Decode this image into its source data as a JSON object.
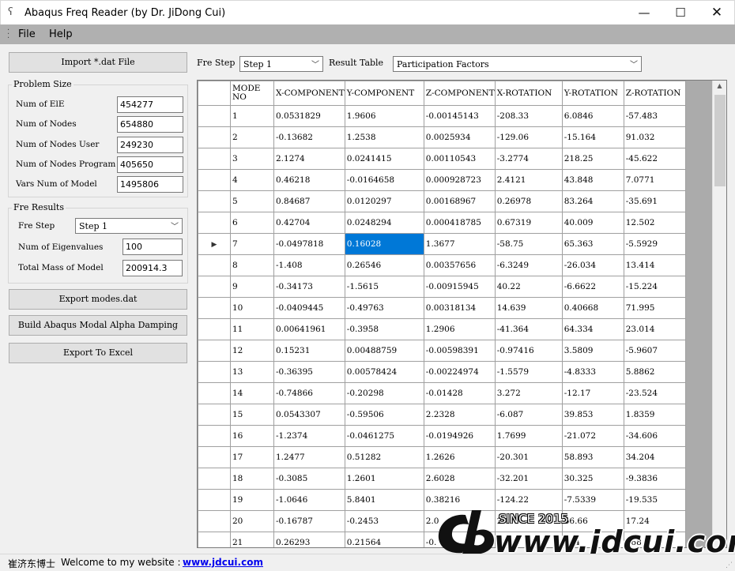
{
  "window": {
    "title": "Abaqus Freq Reader (by Dr. JiDong Cui)",
    "min_glyph": "—",
    "max_glyph": "☐",
    "close_glyph": "✕"
  },
  "menu": {
    "file": "File",
    "help": "Help"
  },
  "left_panel": {
    "import_button": "Import *.dat File",
    "problem_size": {
      "title": "Problem Size",
      "fields": [
        {
          "label": "Num of ElE",
          "value": "454277"
        },
        {
          "label": "Num of Nodes",
          "value": "654880"
        },
        {
          "label": "Num of Nodes User",
          "value": "249230"
        },
        {
          "label": "Num of Nodes Program",
          "value": "405650"
        },
        {
          "label": "Vars Num of Model",
          "value": "1495806"
        }
      ]
    },
    "fre_results": {
      "title": "Fre Results",
      "step_label": "Fre Step",
      "step_value": "Step 1",
      "fields": [
        {
          "label": "Num of Eigenvalues",
          "value": "100"
        },
        {
          "label": "Total Mass of Model",
          "value": "200914.3"
        }
      ]
    },
    "export_modes_button": "Export  modes.dat",
    "build_damping_button": "Build Abaqus Modal Alpha Damping",
    "export_excel_button": "Export To Excel"
  },
  "toolbar": {
    "fre_step_label": "Fre Step",
    "fre_step_value": "Step 1",
    "result_table_label": "Result Table",
    "result_table_value": "Participation Factors"
  },
  "grid": {
    "columns": [
      "MODE NO",
      "X-COMPONENT",
      "Y-COMPONENT",
      "Z-COMPONENT",
      "X-ROTATION",
      "Y-ROTATION",
      "Z-ROTATION"
    ],
    "current_row_index": 6,
    "selected_cell": {
      "row": 6,
      "col": 2
    },
    "rows": [
      [
        "1",
        "0.0531829",
        "1.9606",
        "-0.00145143",
        "-208.33",
        "6.0846",
        "-57.483"
      ],
      [
        "2",
        "-0.13682",
        "1.2538",
        "0.0025934",
        "-129.06",
        "-15.164",
        "91.032"
      ],
      [
        "3",
        "2.1274",
        "0.0241415",
        "0.00110543",
        "-3.2774",
        "218.25",
        "-45.622"
      ],
      [
        "4",
        "0.46218",
        "-0.0164658",
        "0.000928723",
        "2.4121",
        "43.848",
        "7.0771"
      ],
      [
        "5",
        "0.84687",
        "0.0120297",
        "0.00168967",
        "0.26978",
        "83.264",
        "-35.691"
      ],
      [
        "6",
        "0.42704",
        "0.0248294",
        "0.000418785",
        "0.67319",
        "40.009",
        "12.502"
      ],
      [
        "7",
        "-0.0497818",
        "0.16028",
        "1.3677",
        "-58.75",
        "65.363",
        "-5.5929"
      ],
      [
        "8",
        "-1.408",
        "0.26546",
        "0.00357656",
        "-6.3249",
        "-26.034",
        "13.414"
      ],
      [
        "9",
        "-0.34173",
        "-1.5615",
        "-0.00915945",
        "40.22",
        "-6.6622",
        "-15.224"
      ],
      [
        "10",
        "-0.0409445",
        "-0.49763",
        "0.00318134",
        "14.639",
        "0.40668",
        "71.995"
      ],
      [
        "11",
        "0.00641961",
        "-0.3958",
        "1.2906",
        "-41.364",
        "64.334",
        "23.014"
      ],
      [
        "12",
        "0.15231",
        "0.00488759",
        "-0.00598391",
        "-0.97416",
        "3.5809",
        "-5.9607"
      ],
      [
        "13",
        "-0.36395",
        "0.00578424",
        "-0.00224974",
        "-1.5579",
        "-4.8333",
        "5.8862"
      ],
      [
        "14",
        "-0.74866",
        "-0.20298",
        "-0.01428",
        "3.272",
        "-12.17",
        "-23.524"
      ],
      [
        "15",
        "0.0543307",
        "-0.59506",
        "2.2328",
        "-6.087",
        "39.853",
        "1.8359"
      ],
      [
        "16",
        "-1.2374",
        "-0.0461275",
        "-0.0194926",
        "1.7699",
        "-21.072",
        "-34.606"
      ],
      [
        "17",
        "1.2477",
        "0.51282",
        "1.2626",
        "-20.301",
        "58.893",
        "34.204"
      ],
      [
        "18",
        "-0.3085",
        "1.2601",
        "2.6028",
        "-32.201",
        "30.325",
        "-9.3836"
      ],
      [
        "19",
        "-1.0646",
        "5.8401",
        "0.38216",
        "-124.22",
        "-7.5339",
        "-19.535"
      ],
      [
        "20",
        "-0.16787",
        "-0.2453",
        "2.0",
        "2.1",
        "56.66",
        "17.24"
      ],
      [
        "21",
        "0.26293",
        "0.21564",
        "-0.",
        "51",
        "804",
        "768"
      ]
    ]
  },
  "status": {
    "author": "崔济东博士",
    "welcome": "Welcome to my website :",
    "link": "www.jdcui.com"
  },
  "watermark": {
    "since": "SINCE 2015",
    "url": "www.jdcui.com"
  }
}
